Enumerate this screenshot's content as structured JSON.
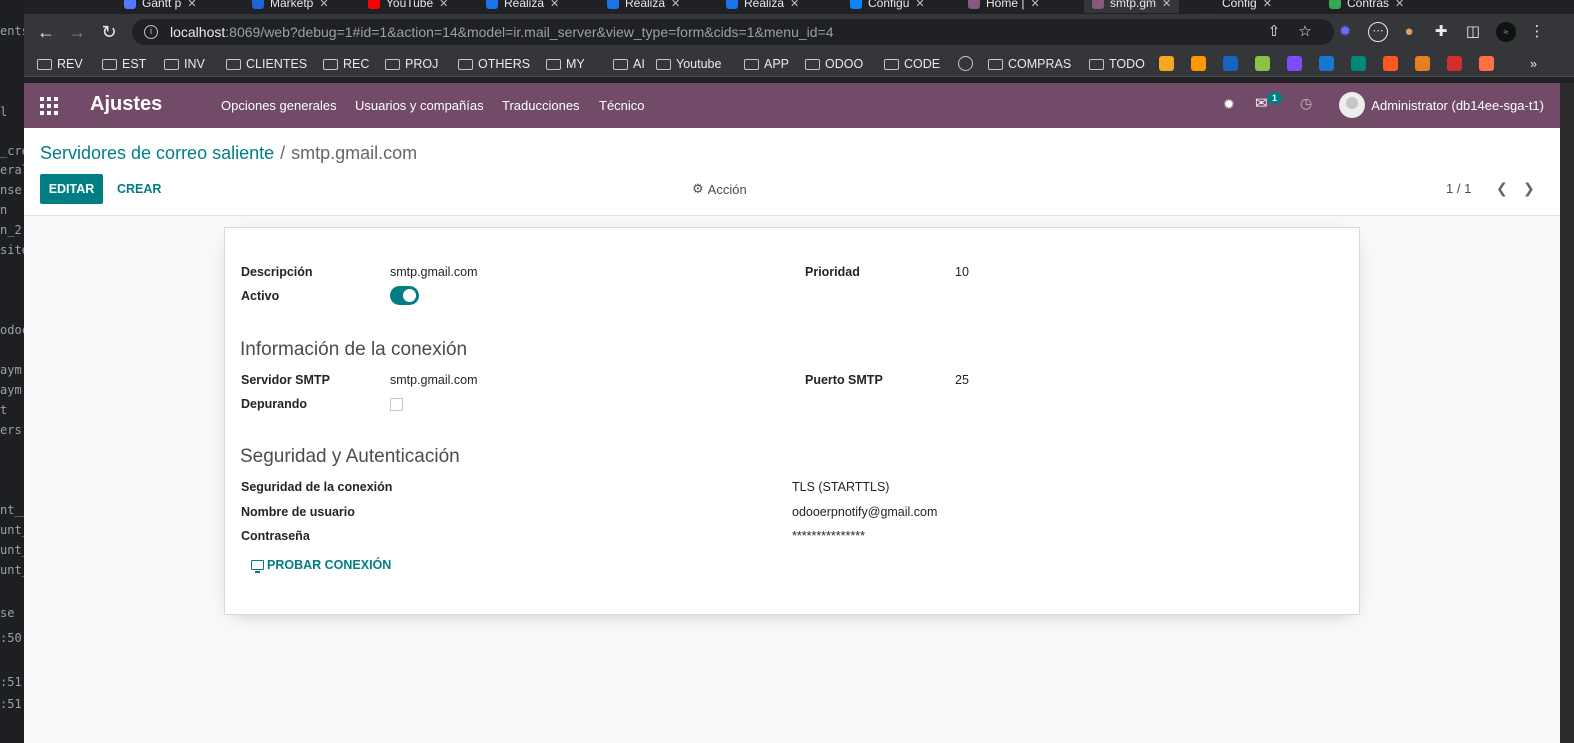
{
  "browser": {
    "tabs": [
      {
        "label": "Gantt p",
        "color": "#4f7bff"
      },
      {
        "label": "Marketp",
        "color": "#1967d2"
      },
      {
        "label": "YouTube",
        "color": "#ff0000"
      },
      {
        "label": "Realiza",
        "color": "#1a73e8"
      },
      {
        "label": "Realiza",
        "color": "#1a73e8"
      },
      {
        "label": "Realiza",
        "color": "#1a73e8"
      },
      {
        "label": "Configu",
        "color": "#0a84ff"
      },
      {
        "label": "Home | ",
        "color": "#875a7b"
      },
      {
        "label": "smtp.gm",
        "color": "#875a7b"
      },
      {
        "label": "Config",
        "color": "#202124"
      },
      {
        "label": "Contras",
        "color": "#34a853"
      }
    ],
    "url_host": "localhost",
    "url_rest": ":8069/web?debug=1#id=1&action=14&model=ir.mail_server&view_type=form&cids=1&menu_id=4",
    "bookmarks": [
      "REV",
      "EST",
      "INV",
      "CLIENTES",
      "REC",
      "PROJ",
      "OTHERS",
      "MY",
      "AI",
      "Youtube",
      "APP",
      "ODOO",
      "CODE",
      "COMPRAS",
      "TODO"
    ],
    "more_bookmarks": "»"
  },
  "left_strip_text": [
    "ents",
    "l",
    "_cre",
    "eral",
    "nse",
    "n",
    "n_2",
    "site",
    "odoc",
    "aym",
    "aym",
    "t",
    "ers",
    "nt__",
    "unt_",
    "unt_",
    "unt_",
    "se",
    ":50",
    ":51",
    ":51"
  ],
  "navbar": {
    "brand": "Ajustes",
    "menu": [
      "Opciones generales",
      "Usuarios y compañías",
      "Traducciones",
      "Técnico"
    ],
    "messages_count": "1",
    "user": "Administrator (db14ee-sga-t1)"
  },
  "control_panel": {
    "breadcrumb_parent": "Servidores de correo saliente",
    "breadcrumb_separator": "/",
    "breadcrumb_current": "smtp.gmail.com",
    "edit_label": "EDITAR",
    "create_label": "CREAR",
    "action_label": "Acción",
    "pager": "1 / 1"
  },
  "form": {
    "description_label": "Descripción",
    "description_value": "smtp.gmail.com",
    "active_label": "Activo",
    "active": true,
    "priority_label": "Prioridad",
    "priority_value": "10",
    "connection_title": "Información de la conexión",
    "smtp_server_label": "Servidor SMTP",
    "smtp_server_value": "smtp.gmail.com",
    "debug_label": "Depurando",
    "debug": false,
    "smtp_port_label": "Puerto SMTP",
    "smtp_port_value": "25",
    "security_title": "Seguridad y Autenticación",
    "encryption_label": "Seguridad de la conexión",
    "encryption_value": "TLS (STARTTLS)",
    "username_label": "Nombre de usuario",
    "username_value": "odooerpnotify@gmail.com",
    "password_label": "Contraseña",
    "password_value": "***************",
    "test_button": "PROBAR CONEXIÓN"
  },
  "colors": {
    "brand": "#714b67",
    "accent": "#017e84"
  }
}
